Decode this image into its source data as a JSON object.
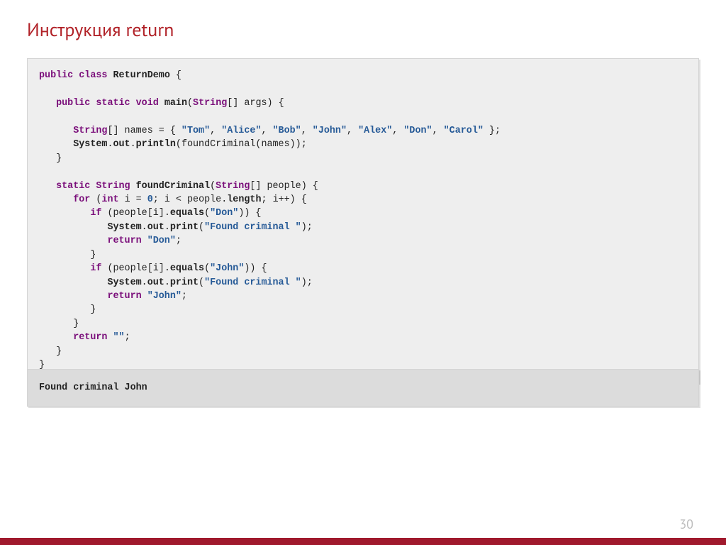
{
  "title": "Инструкция return",
  "c": {
    "public": "public",
    "class": "class",
    "static": "static",
    "void": "void",
    "int": "int",
    "for": "for",
    "if": "if",
    "return": "return",
    "String": "String",
    "ReturnDemo": "ReturnDemo",
    "main": "main",
    "args": "args",
    "names": "names",
    "people": "people",
    "System": "System",
    "out": "out",
    "println": "println",
    "print": "print",
    "foundCriminal": "foundCriminal",
    "equals": "equals",
    "length": "length",
    "i": "i",
    "zero": "0",
    "Tom": "\"Tom\"",
    "Alice": "\"Alice\"",
    "Bob": "\"Bob\"",
    "John": "\"John\"",
    "Alex": "\"Alex\"",
    "Don": "\"Don\"",
    "Carol": "\"Carol\"",
    "FoundCriminal": "\"Found criminal \"",
    "empty": "\"\""
  },
  "output": "Found criminal John",
  "pagenum": "30"
}
